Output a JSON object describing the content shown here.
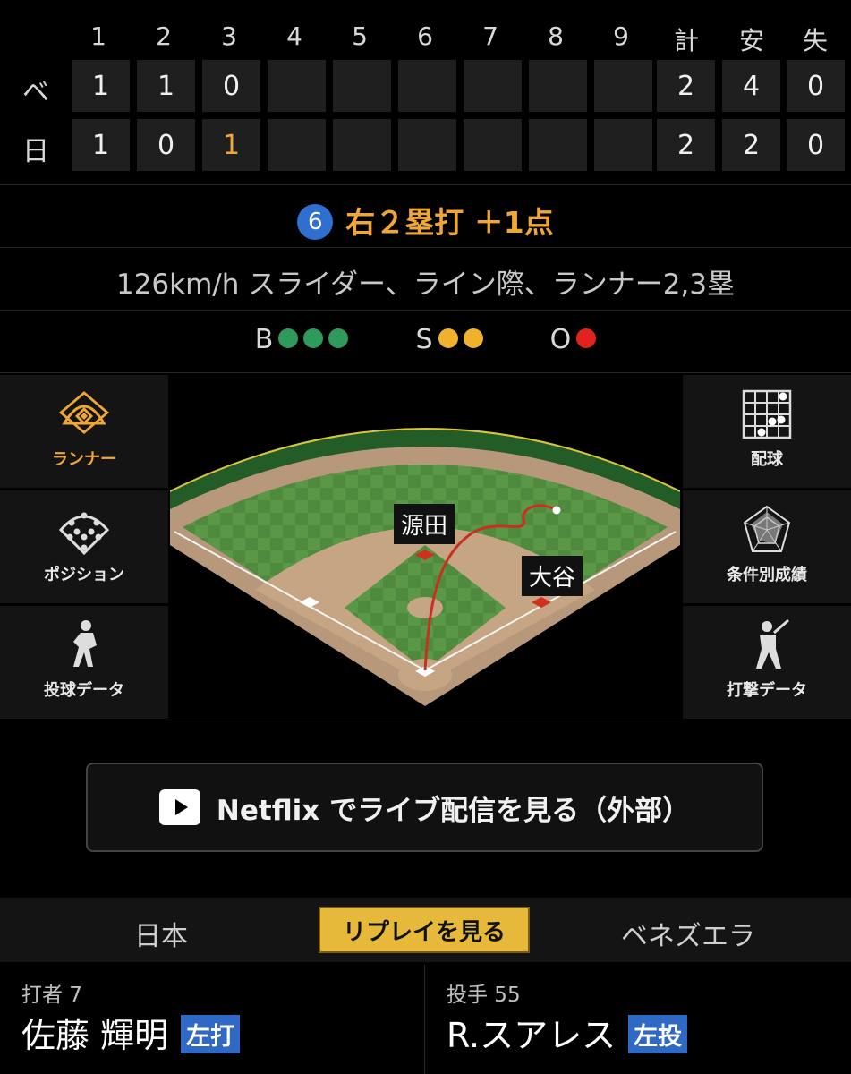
{
  "scoreboard": {
    "headers": [
      "1",
      "2",
      "3",
      "4",
      "5",
      "6",
      "7",
      "8",
      "9",
      "計",
      "安",
      "失"
    ],
    "rows": [
      {
        "team": "ベ",
        "innings": [
          "1",
          "1",
          "0",
          "",
          "",
          "",
          "",
          "",
          ""
        ],
        "runs": "2",
        "hits": "4",
        "errors": "0"
      },
      {
        "team": "日",
        "innings": [
          "1",
          "0",
          "1",
          "",
          "",
          "",
          "",
          "",
          ""
        ],
        "runs": "2",
        "hits": "2",
        "errors": "0"
      }
    ],
    "highlight_color": "#f0a637"
  },
  "play": {
    "batter_order": "6",
    "result": "右２塁打 ＋1点",
    "pitch_detail": "126km/h スライダー、ライン際、ランナー2,3塁"
  },
  "count": {
    "balls_label": "B",
    "balls": 3,
    "ball_color": "#2e9a5c",
    "strikes_label": "S",
    "strikes": 2,
    "strike_color": "#f0b12c",
    "outs_label": "O",
    "outs": 1,
    "out_color": "#e0231c"
  },
  "left_menu": [
    {
      "label": "ランナー",
      "icon": "diamond-icon",
      "active": true
    },
    {
      "label": "ポジション",
      "icon": "positions-icon",
      "active": false
    },
    {
      "label": "投球データ",
      "icon": "pitcher-icon",
      "active": false
    }
  ],
  "right_menu": [
    {
      "label": "配球",
      "icon": "grid-icon"
    },
    {
      "label": "条件別成績",
      "icon": "radar-icon"
    },
    {
      "label": "打撃データ",
      "icon": "batter-icon"
    }
  ],
  "field": {
    "runner_second": "源田",
    "runner_third": "大谷"
  },
  "stream_button": "Netflix でライブ配信を見る（外部）",
  "tabs": {
    "home": "日本",
    "replay": "リプレイを見る",
    "away": "ベネズエラ"
  },
  "batter": {
    "role": "打者 7",
    "name": "佐藤 輝明",
    "hand": "左打"
  },
  "pitcher": {
    "role": "投手 55",
    "name": "R.スアレス",
    "hand": "左投"
  }
}
